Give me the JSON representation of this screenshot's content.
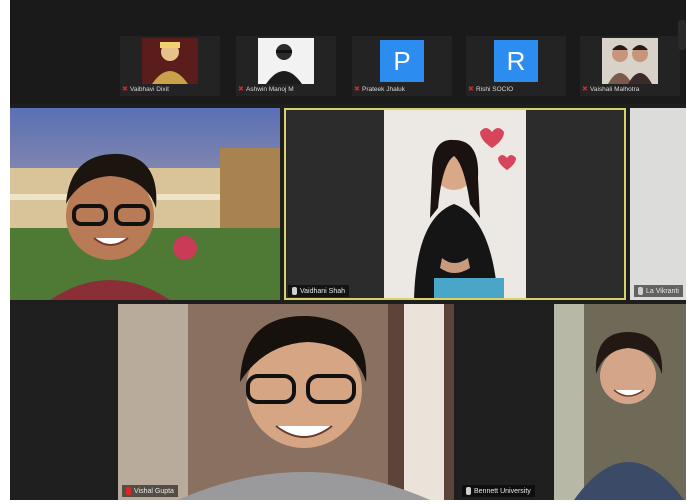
{
  "strip": {
    "participants": [
      {
        "name": "Vaibhavi Dixit",
        "type": "avatar"
      },
      {
        "name": "Ashwin Manoj M",
        "type": "avatar"
      },
      {
        "name": "Prateek Jhaluk",
        "type": "initial",
        "initial": "P"
      },
      {
        "name": "Rishi SOCIO",
        "type": "initial",
        "initial": "R"
      },
      {
        "name": "Vaishali Malhotra",
        "type": "avatar"
      }
    ]
  },
  "gallery": {
    "tiles": [
      {
        "name": "",
        "position": "top-left"
      },
      {
        "name": "Vaidhani Shah",
        "position": "top-center"
      },
      {
        "name": "La Vikranti",
        "position": "top-right"
      },
      {
        "name": "",
        "position": "bottom-left"
      },
      {
        "name": "Vishal Gupta",
        "position": "bottom-center"
      },
      {
        "name": "Bennett University",
        "position": "bottom-right"
      }
    ]
  },
  "colors": {
    "active_speaker_border": "#d7d36a",
    "avatar_blue": "#2d8cf0",
    "muted_red": "#e02424"
  }
}
